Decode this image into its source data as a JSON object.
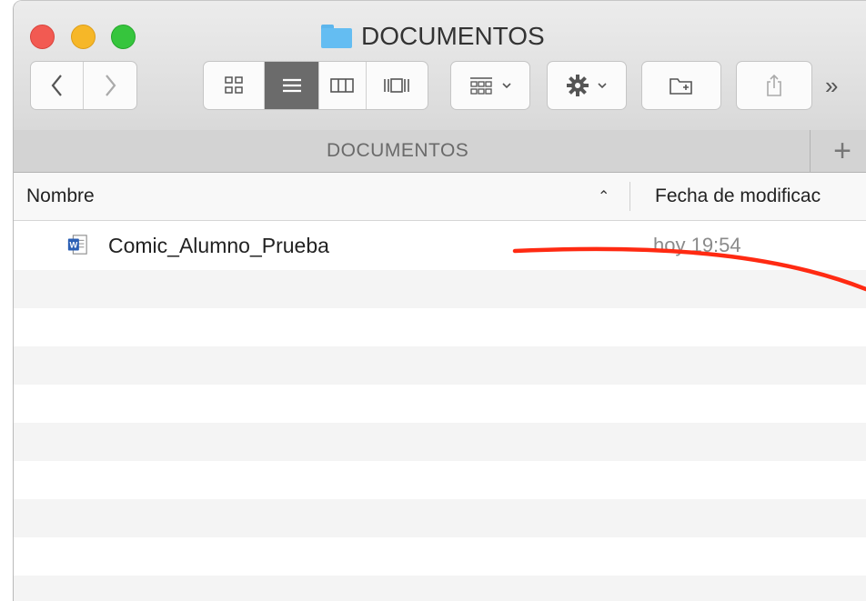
{
  "window": {
    "title": "DOCUMENTOS"
  },
  "toolbar": {
    "back_icon": "chevron-left-icon",
    "forward_icon": "chevron-right-icon",
    "view_modes": [
      "icon-view-icon",
      "list-view-icon",
      "column-view-icon",
      "cover-flow-icon"
    ],
    "active_view": "list-view-icon",
    "arrange_icon": "arrange-icon",
    "action_icon": "gear-icon",
    "new_folder_icon": "new-folder-icon",
    "share_icon": "share-icon",
    "overflow_label": "»"
  },
  "tabbar": {
    "tab_label": "DOCUMENTOS",
    "add_label": "+"
  },
  "columns": {
    "name": "Nombre",
    "date": "Fecha de modificac"
  },
  "files": [
    {
      "name": "Comic_Alumno_Prueba",
      "date": "hoy 19:54",
      "icon": "word-document-icon"
    }
  ],
  "colors": {
    "annotation_line": "#ff2a12",
    "active_segment": "#6b6b6b",
    "folder_blue": "#64bdf2"
  }
}
